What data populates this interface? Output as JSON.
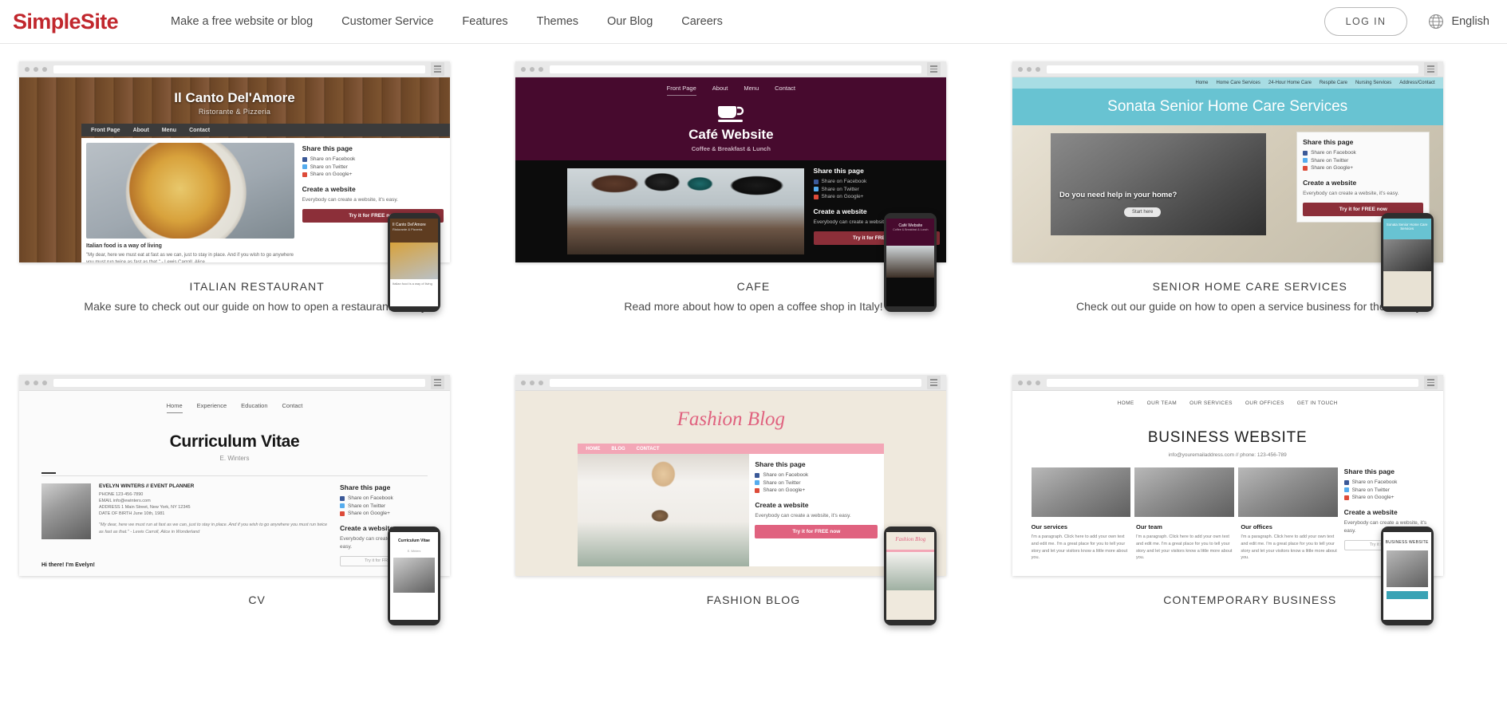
{
  "header": {
    "logo": "SimpleSite",
    "nav": [
      {
        "label": "Make a free website or blog"
      },
      {
        "label": "Customer Service"
      },
      {
        "label": "Features"
      },
      {
        "label": "Themes"
      },
      {
        "label": "Our Blog"
      },
      {
        "label": "Careers"
      }
    ],
    "login_label": "LOG IN",
    "language": "English",
    "globe_icon": "globe-icon",
    "brand_color": "#c1272d"
  },
  "shared": {
    "share_heading": "Share this page",
    "share_facebook": "Share on Facebook",
    "share_twitter": "Share on Twitter",
    "share_google": "Share on Google+",
    "create_heading": "Create a website",
    "create_text": "Everybody can create a website, it's easy.",
    "create_button": "Try it for FREE now",
    "try_free_small": "Try it for FREE now"
  },
  "cards": [
    {
      "id": "italian-restaurant",
      "title": "ITALIAN RESTAURANT",
      "description": "Make sure to check out our guide on how to open a restaurant in Italy!",
      "site": {
        "name": "Il Canto Del'Amore",
        "tagline": "Ristorante & Pizzeria",
        "nav": [
          "Front Page",
          "About",
          "Menu",
          "Contact"
        ],
        "article_title": "Italian food is a way of living",
        "article_text": "\"My dear, here we must eat at fast as we can, just to stay in place. And if you wish to go anywhere you must run twice as fast as that.\" - Lewis Carroll, Alice",
        "accent": "#8c2f39"
      }
    },
    {
      "id": "cafe",
      "title": "CAFE",
      "description": "Read more about how to open a coffee shop in Italy!",
      "site": {
        "name": "Café Website",
        "tagline": "Coffee & Breakfast & Lunch",
        "nav": [
          "Front Page",
          "About",
          "Menu",
          "Contact"
        ],
        "icon": "coffee-cup-icon",
        "accent": "#470a2e"
      }
    },
    {
      "id": "senior-home-care-services",
      "title": "SENIOR HOME CARE SERVICES",
      "description": "Check out our guide on how to open a service business for the elderly.",
      "site": {
        "name": "Sonata Senior Home Care Services",
        "nav": [
          "Home",
          "Home Care Services",
          "24-Hour Home Care",
          "Respite Care",
          "Nursing Services",
          "Address/Contact"
        ],
        "hero_question": "Do you need help in your home?",
        "hero_button": "Start here",
        "accent": "#68c3d2"
      }
    },
    {
      "id": "cv",
      "title": "CV",
      "description": "",
      "site": {
        "name": "Curriculum Vitae",
        "tagline": "E. Winters",
        "nav": [
          "Home",
          "Experience",
          "Education",
          "Contact"
        ],
        "person": "EVELYN WINTERS // EVENT PLANNER",
        "phone": "PHONE 123-456-7890",
        "email": "EMAIL info@ewinters.com",
        "address": "ADDRESS 1 Main Street, New York, NY 12345",
        "dob": "DATE OF BIRTH June 10th, 1981",
        "quote": "\"My dear, here we must run at fast as we can, just to stay in place. And if you wish to go anywhere you must run twice as fast as that.\" - Lewis Carroll, Alice in Wonderland",
        "hello": "Hi there! I'm Evelyn!"
      }
    },
    {
      "id": "fashion-blog",
      "title": "FASHION BLOG",
      "description": "",
      "site": {
        "name": "Fashion Blog",
        "nav": [
          "HOME",
          "BLOG",
          "CONTACT"
        ],
        "accent": "#e0627f"
      }
    },
    {
      "id": "contemporary-business",
      "title": "CONTEMPORARY BUSINESS",
      "description": "",
      "site": {
        "name": "BUSINESS WEBSITE",
        "tagline": "info@youremailaddress.com // phone: 123-456-789",
        "nav": [
          "HOME",
          "OUR TEAM",
          "OUR SERVICES",
          "OUR OFFICES",
          "GET IN TOUCH"
        ],
        "columns": [
          {
            "heading": "Our services",
            "text": "I'm a paragraph. Click here to add your own text and edit me. I'm a great place for you to tell your story and let your visitors know a little more about you."
          },
          {
            "heading": "Our team",
            "text": "I'm a paragraph. Click here to add your own text and edit me. I'm a great place for you to tell your story and let your visitors know a little more about you."
          },
          {
            "heading": "Our offices",
            "text": "I'm a paragraph. Click here to add your own text and edit me. I'm a great place for you to tell your story and let your visitors know a little more about you."
          }
        ]
      }
    }
  ]
}
